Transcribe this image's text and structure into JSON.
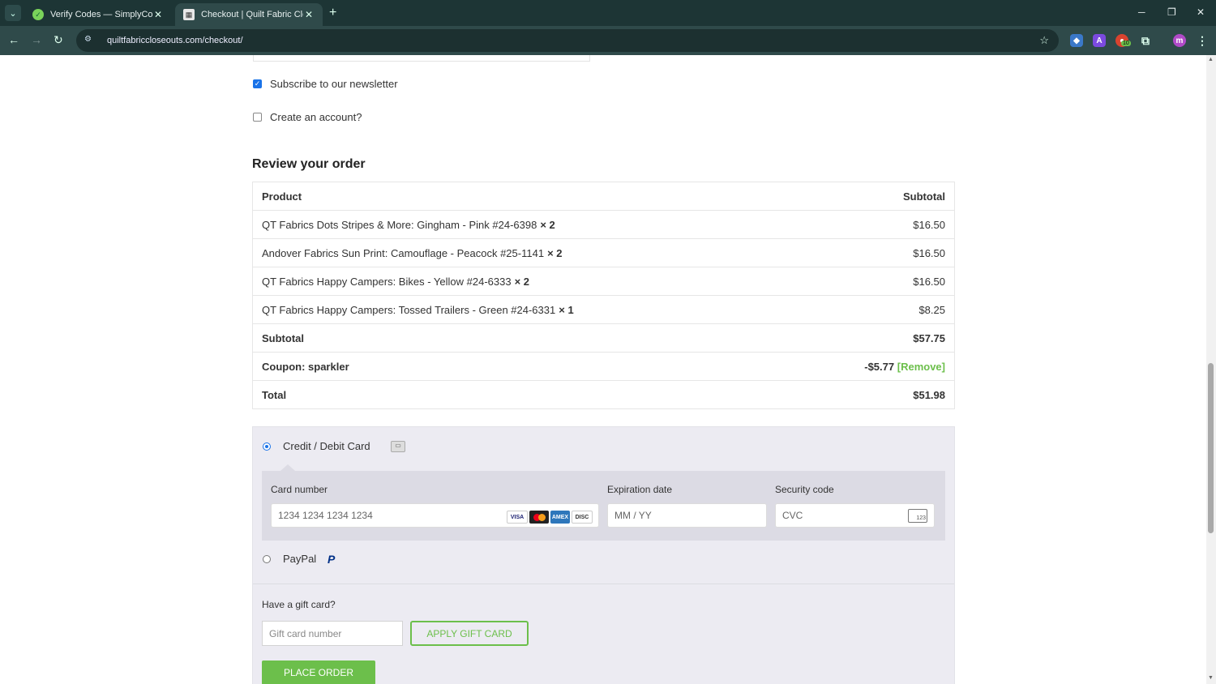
{
  "browser": {
    "tabs": [
      {
        "title": "Verify Codes — SimplyCodes",
        "favicon": "simplycodes-check-icon"
      },
      {
        "title": "Checkout | Quilt Fabric Closeou",
        "favicon": "quilt-fabric-icon"
      }
    ],
    "url": "quiltfabriccloseouts.com/checkout/",
    "extension_badge": "10",
    "profile_initial": "m"
  },
  "checkout": {
    "newsletter_label": "Subscribe to our newsletter",
    "newsletter_checked": true,
    "create_account_label": "Create an account?",
    "create_account_checked": false,
    "review_title": "Review your order",
    "table": {
      "header_product": "Product",
      "header_subtotal": "Subtotal",
      "items": [
        {
          "name": "QT Fabrics Dots Stripes & More: Gingham - Pink #24-6398",
          "qty": "× 2",
          "price": "$16.50"
        },
        {
          "name": "Andover Fabrics Sun Print: Camouflage - Peacock #25-1141",
          "qty": "× 2",
          "price": "$16.50"
        },
        {
          "name": "QT Fabrics Happy Campers: Bikes - Yellow #24-6333",
          "qty": "× 2",
          "price": "$16.50"
        },
        {
          "name": "QT Fabrics Happy Campers: Tossed Trailers - Green #24-6331",
          "qty": "× 1",
          "price": "$8.25"
        }
      ],
      "subtotal_label": "Subtotal",
      "subtotal_value": "$57.75",
      "coupon_label": "Coupon: sparkler",
      "coupon_value": "-$5.77",
      "coupon_remove": "[Remove]",
      "total_label": "Total",
      "total_value": "$51.98"
    },
    "payment": {
      "card_option_label": "Credit / Debit Card",
      "card_number_label": "Card number",
      "card_number_placeholder": "1234 1234 1234 1234",
      "expiration_label": "Expiration date",
      "expiration_placeholder": "MM / YY",
      "security_label": "Security code",
      "security_placeholder": "CVC",
      "brands": [
        "VISA",
        "MC",
        "AMEX",
        "DISCOVER"
      ],
      "paypal_label": "PayPal",
      "selected": "card"
    },
    "gift": {
      "label": "Have a gift card?",
      "placeholder": "Gift card number",
      "apply_button": "APPLY GIFT CARD"
    },
    "place_order_button": "PLACE ORDER"
  },
  "colors": {
    "accent_green": "#6cbf4b",
    "chrome_dark": "#1d3535",
    "link_blue": "#1a73e8"
  }
}
